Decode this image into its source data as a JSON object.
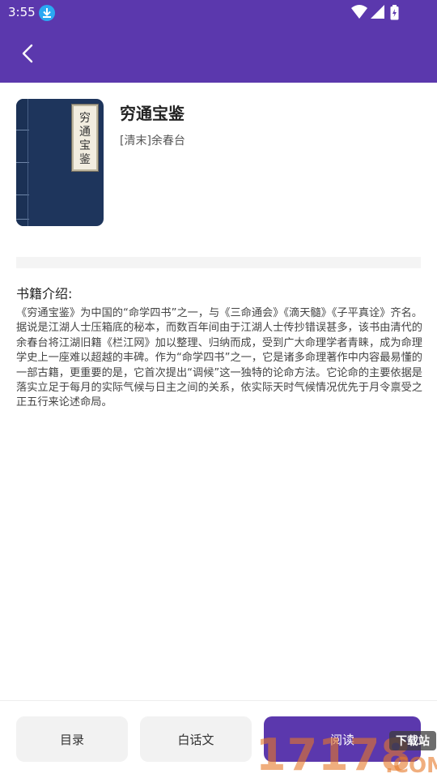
{
  "status_bar": {
    "time": "3:55"
  },
  "header": {
    "back_icon": "chevron-left-icon"
  },
  "book": {
    "title": "穷通宝鉴",
    "author": "[清末]余春台",
    "cover_label": "穷通宝鉴"
  },
  "intro": {
    "heading": "书籍介绍:",
    "text": "《穷通宝鉴》为中国的“命学四书”之一，与《三命通会》《滴天髓》《子平真诠》齐名。据说是江湖人士压箱底的秘本，而数百年间由于江湖人士传抄错误甚多，该书由清代的余春台将江湖旧籍《栏江网》加以整理、归纳而成，受到广大命理学者青睐，成为命理学史上一座难以超越的丰碑。作为“命学四书”之一，它是诸多命理著作中内容最易懂的一部古籍，更重要的是，它首次提出“调候”这一独特的论命方法。它论命的主要依据是落实立足于每月的实际气候与日主之间的关系，依实际天时气候情况优先于月令禀受之正五行来论述命局。"
  },
  "actions": {
    "catalog_label": "目录",
    "vernacular_label": "白话文",
    "read_label": "阅读"
  },
  "watermark": {
    "number": "17178",
    "suffix": ".COM",
    "badge": "下载站"
  },
  "colors": {
    "accent": "#5b38ad",
    "cover": "#1e355c"
  }
}
